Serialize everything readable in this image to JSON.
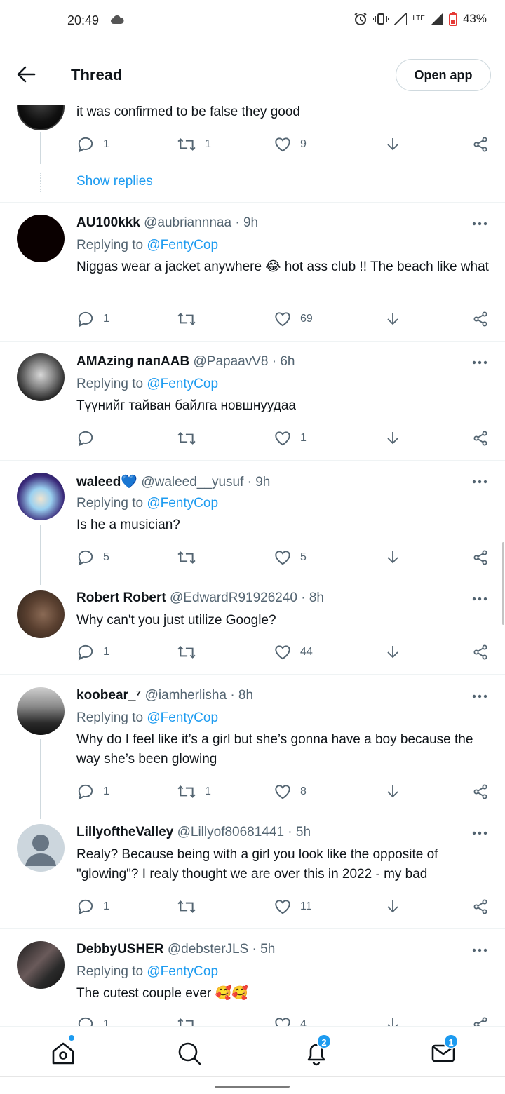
{
  "status_bar": {
    "time": "20:49",
    "network": "LTE",
    "battery": "43%"
  },
  "header": {
    "title": "Thread",
    "open_app": "Open app"
  },
  "top_tweet": {
    "text": "it was confirmed to be false  they good",
    "replies": "1",
    "retweets": "1",
    "likes": "9",
    "show_replies": "Show replies"
  },
  "tweets": [
    {
      "name": "AU100kkk",
      "handle": "@aubriannnaa · 9h",
      "replying_prefix": "Replying to",
      "replying_to": "@FentyCop",
      "text": "Niggas wear a jacket anywhere 😂 hot ass club !! The beach like what",
      "replies": "1",
      "retweets": "",
      "likes": "69"
    },
    {
      "name": "AMAzing папААВ",
      "handle": "@PapaavV8 · 6h",
      "replying_prefix": "Replying to",
      "replying_to": "@FentyCop",
      "text": "Түүнийг тайван байлга новшнуудаа",
      "replies": "",
      "retweets": "",
      "likes": "1"
    },
    {
      "name": "waleed💙",
      "handle": "@waleed__yusuf · 9h",
      "replying_prefix": "Replying to",
      "replying_to": "@FentyCop",
      "text": "Is he a musician?",
      "replies": "5",
      "retweets": "",
      "likes": "5"
    },
    {
      "name": "Robert Robert",
      "handle": "@EdwardR91926240 · 8h",
      "text": "Why can't you just utilize Google?",
      "replies": "1",
      "retweets": "",
      "likes": "44"
    },
    {
      "name": "koobear_⁷",
      "handle": "@iamherlisha · 8h",
      "replying_prefix": "Replying to",
      "replying_to": "@FentyCop",
      "text": "Why do I feel like it’s a girl but she’s gonna have a boy because the way she’s been glowing",
      "replies": "1",
      "retweets": "1",
      "likes": "8"
    },
    {
      "name": "LillyoftheValley",
      "handle": "@Lillyof80681441 · 5h",
      "text": "Realy? Because being with a girl you look like the opposite of \"glowing\"? I realy thought we are over this in 2022 - my bad",
      "replies": "1",
      "retweets": "",
      "likes": "11"
    },
    {
      "name": "DebbyUSHER",
      "handle": "@debsterJLS · 5h",
      "replying_prefix": "Replying to",
      "replying_to": "@FentyCop",
      "text": "The cutest couple ever 🥰🥰",
      "replies": "1",
      "retweets": "",
      "likes": "4"
    }
  ],
  "bottom_nav": {
    "notifications_badge": "2",
    "messages_badge": "1"
  },
  "colors": {
    "accent": "#1d9bf0",
    "text": "#0f1419",
    "secondary": "#536471",
    "divider": "#eff3f4"
  }
}
